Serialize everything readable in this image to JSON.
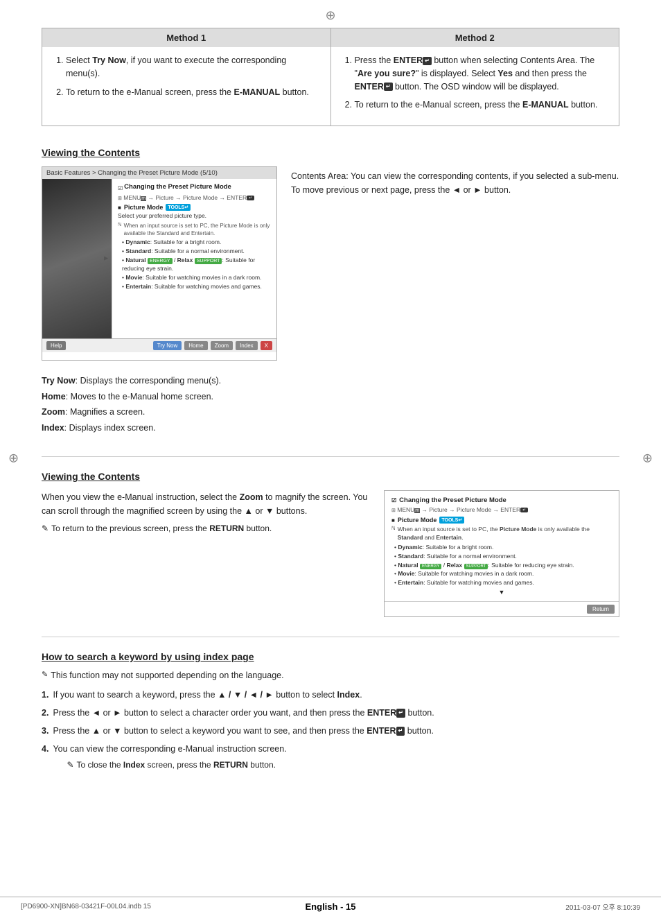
{
  "page": {
    "crosshair_symbol": "⊕"
  },
  "methods": {
    "method1": {
      "header": "Method 1",
      "steps": [
        {
          "num": "1.",
          "text": "Select Try Now, if you want to execute the corresponding menu(s)."
        },
        {
          "num": "2.",
          "text": "To return to the e-Manual screen, press the E-MANUAL button."
        }
      ]
    },
    "method2": {
      "header": "Method 2",
      "steps": [
        {
          "num": "1.",
          "text": "Press the ENTER button when selecting Contents Area. The \"Are you sure?\" is displayed. Select Yes and then press the ENTER button. The OSD window will be displayed."
        },
        {
          "num": "2.",
          "text": "To return to the e-Manual screen, press the E-MANUAL button."
        }
      ]
    }
  },
  "viewing_contents_1": {
    "section_title": "Viewing the Contents",
    "emulator": {
      "topbar": "Basic Features > Changing the Preset Picture Mode (5/10)",
      "title": "Changing the Preset Picture Mode",
      "menu_path": "MENU → Picture → Picture Mode → ENTER",
      "section_label": "Picture Mode",
      "badge_text": "TOOLS↵",
      "select_text": "Select your preferred picture type.",
      "note_text": "When an input source is set to PC, the Picture Mode is only available the Standard and Entertain.",
      "bullets": [
        "Dynamic: Suitable for a bright room.",
        "Standard: Suitable for a normal environment.",
        "Natural ENERGY / Relax SUPPORT: Suitable for reducing eye strain.",
        "Movie: Suitable for watching movies in a dark room.",
        "Entertain: Suitable for watching movies and games."
      ],
      "buttons": {
        "help": "Help",
        "try_now": "Try Now",
        "home": "Home",
        "zoom": "Zoom",
        "index": "Index",
        "close": "X"
      }
    },
    "description": "Contents Area: You can view the corresponding contents, if you selected a sub-menu. To move previous or next page, press the ◄ or ► button.",
    "labels": {
      "try_now": "Try Now: Displays the corresponding menu(s).",
      "home": "Home: Moves to the e-Manual home screen.",
      "zoom": "Zoom: Magnifies a screen.",
      "index": "Index: Displays index screen."
    }
  },
  "viewing_contents_2": {
    "section_title": "Viewing the Contents",
    "description_parts": [
      "When you view the e-Manual instruction, select the Zoom to magnify the screen. You can scroll through the magnified screen by using the ▲ or ▼ buttons.",
      "To return to the previous screen, press the RETURN button."
    ],
    "emulator": {
      "title": "Changing the Preset Picture Mode",
      "menu_path": "MENU → Picture → Picture Mode → ENTER",
      "section_label": "Picture Mode",
      "badge_text": "TOOLS↵",
      "note_text": "When an input source is set to PC, the Picture Mode is only available the Standard and Entertain.",
      "bullets": [
        "Dynamic: Suitable for a bright room.",
        "Standard: Suitable for a normal environment.",
        "Natural ENERGY / Relax SUPPORT: Suitable for reducing eye strain.",
        "Movie: Suitable for watching movies in a dark room.",
        "Entertain: Suitable for watching movies and games."
      ],
      "arrow_down": "▼",
      "return_btn": "Return"
    }
  },
  "index_search": {
    "section_title": "How to search a keyword by using index page",
    "note": "This function may not supported depending on the language.",
    "steps": [
      {
        "num": "1.",
        "text": "If you want to search a keyword, press the ▲ / ▼ / ◄ / ► button to select Index."
      },
      {
        "num": "2.",
        "text": "Press the ◄ or ► button to select a character order you want, and then press the ENTER button."
      },
      {
        "num": "3.",
        "text": "Press the ▲ or ▼ button to select a keyword you want to see, and then press the ENTER button."
      },
      {
        "num": "4.",
        "text": "You can view the corresponding e-Manual instruction screen.",
        "subnote": "To close the Index screen, press the RETURN button."
      }
    ]
  },
  "footer": {
    "left": "[PD6900-XN]BN68-03421F-00L04.indb   15",
    "center": "English - 15",
    "right": "2011-03-07   오후 8:10:39"
  }
}
